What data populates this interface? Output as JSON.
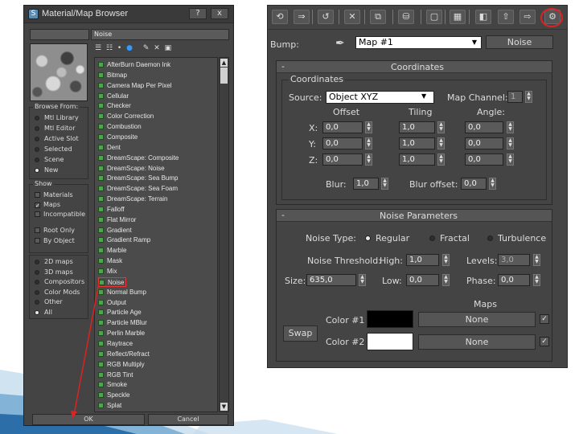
{
  "browser": {
    "title": "Material/Map Browser",
    "help_label": "?",
    "close_label": "x",
    "selected_name": "Noise",
    "browse_from": {
      "title": "Browse From:",
      "options": [
        "Mtl Library",
        "Mtl Editor",
        "Active Slot",
        "Selected",
        "Scene",
        "New"
      ],
      "selected": "New"
    },
    "show": {
      "title": "Show",
      "options": [
        {
          "label": "Materials",
          "checked": false
        },
        {
          "label": "Maps",
          "checked": true
        },
        {
          "label": "Incompatible",
          "checked": false
        }
      ],
      "extra": [
        {
          "label": "Root Only",
          "checked": false
        },
        {
          "label": "By Object",
          "checked": false
        }
      ]
    },
    "map_types": {
      "options": [
        "2D maps",
        "3D maps",
        "Compositors",
        "Color Mods",
        "Other",
        "All"
      ],
      "selected": "All"
    },
    "list_items": [
      "AfterBurn Daemon Ink",
      "Bitmap",
      "Camera Map Per Pixel",
      "Cellular",
      "Checker",
      "Color Correction",
      "Combustion",
      "Composite",
      "Dent",
      "DreamScape: Composite",
      "DreamScape: Noise",
      "DreamScape: Sea Bump",
      "DreamScape: Sea Foam",
      "DreamScape: Terrain",
      "Falloff",
      "Flat Mirror",
      "Gradient",
      "Gradient Ramp",
      "Marble",
      "Mask",
      "Mix",
      "Noise",
      "Normal Bump",
      "Output",
      "Particle Age",
      "Particle MBlur",
      "Perlin Marble",
      "Raytrace",
      "Reflect/Refract",
      "RGB Multiply",
      "RGB Tint",
      "Smoke",
      "Speckle",
      "Splat"
    ],
    "highlighted_item": "Noise",
    "ok_label": "OK",
    "cancel_label": "Cancel"
  },
  "editor": {
    "toolbar_icons": [
      "get-material-icon",
      "assign-material-icon",
      "reset-map-icon",
      "delete-icon",
      "make-unique-icon",
      "put-to-library-icon",
      "material-id-icon",
      "show-map-icon",
      "show-end-result-icon",
      "go-to-parent-icon",
      "go-forward-sibling-icon",
      "options-icon"
    ],
    "slot_label": "Bump:",
    "map_name": "Map #1",
    "map_type": "Noise",
    "coordinates": {
      "rollout_title": "Coordinates",
      "collapse": "-",
      "group_label": "Coordinates",
      "source_label": "Source:",
      "source_value": "Object XYZ",
      "map_channel_label": "Map Channel:",
      "map_channel_value": "1",
      "offset_label": "Offset",
      "tiling_label": "Tiling",
      "angle_label": "Angle:",
      "axes": [
        {
          "axis": "X:",
          "offset": "0,0",
          "tiling": "1,0",
          "angle": "0,0"
        },
        {
          "axis": "Y:",
          "offset": "0,0",
          "tiling": "1,0",
          "angle": "0,0"
        },
        {
          "axis": "Z:",
          "offset": "0,0",
          "tiling": "1,0",
          "angle": "0,0"
        }
      ],
      "blur_label": "Blur:",
      "blur_value": "1,0",
      "blur_offset_label": "Blur offset:",
      "blur_offset_value": "0,0"
    },
    "noise": {
      "rollout_title": "Noise Parameters",
      "collapse": "-",
      "noise_type_label": "Noise Type:",
      "types": [
        "Regular",
        "Fractal",
        "Turbulence"
      ],
      "selected_type": "Regular",
      "threshold_label": "Noise Threshold:",
      "high_label": "High:",
      "high_value": "1,0",
      "levels_label": "Levels:",
      "levels_value": "3,0",
      "size_label": "Size:",
      "size_value": "635,0",
      "low_label": "Low:",
      "low_value": "0,0",
      "phase_label": "Phase:",
      "phase_value": "0,0",
      "maps_label": "Maps",
      "swap_label": "Swap",
      "color1_label": "Color #1",
      "color1": "#000000",
      "color1_map": "None",
      "color2_label": "Color #2",
      "color2": "#ffffff",
      "color2_map": "None"
    }
  }
}
